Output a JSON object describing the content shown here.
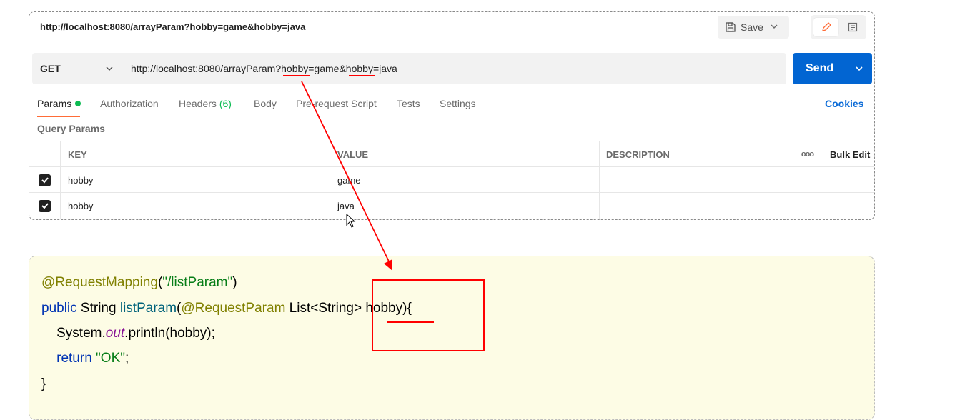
{
  "request": {
    "title": "http://localhost:8080/arrayParam?hobby=game&hobby=java",
    "save_label": "Save",
    "method": "GET",
    "url": "http://localhost:8080/arrayParam?hobby=game&hobby=java",
    "send_label": "Send"
  },
  "tabs": {
    "params": "Params",
    "authorization": "Authorization",
    "headers": "Headers",
    "headers_count": "(6)",
    "body": "Body",
    "prerequest": "Pre-request Script",
    "tests": "Tests",
    "settings": "Settings",
    "cookies": "Cookies"
  },
  "query_params": {
    "title": "Query Params",
    "columns": {
      "key": "KEY",
      "value": "VALUE",
      "description": "DESCRIPTION",
      "more": "ooo",
      "bulk_edit": "Bulk Edit"
    },
    "rows": [
      {
        "key": "hobby",
        "value": "game",
        "description": "",
        "checked": true
      },
      {
        "key": "hobby",
        "value": "java",
        "description": "",
        "checked": true
      }
    ]
  },
  "code": {
    "line1": {
      "annotation": "@RequestMapping",
      "open": "(",
      "path": "\"/listParam\"",
      "close": ")"
    },
    "line2": {
      "kw": "public",
      "type": " String ",
      "method": "listParam",
      "open": "(",
      "annotation": "@RequestParam",
      "rest": " List<String> hobby){"
    },
    "line3": {
      "indent": "    System.",
      "field": "out",
      "rest": ".println(hobby);"
    },
    "line4": {
      "indent": "    ",
      "kw": "return",
      "sp": " ",
      "str": "\"OK\"",
      "end": ";"
    },
    "line5": "}"
  },
  "colors": {
    "send_button": "#0265d2",
    "active_tab_underline": "#ff6c37",
    "annotation_red": "#ff0000",
    "code_background": "#fdfce5"
  }
}
